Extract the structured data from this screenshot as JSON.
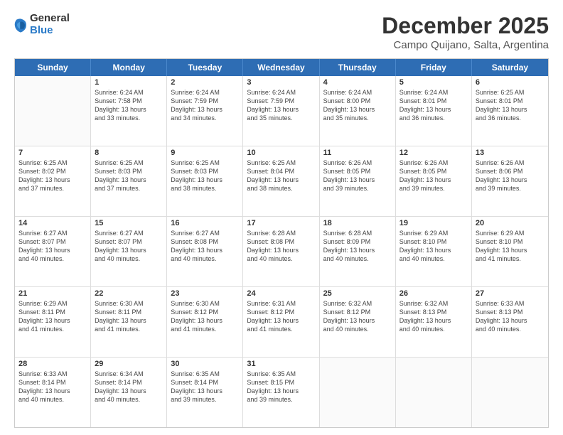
{
  "logo": {
    "general": "General",
    "blue": "Blue"
  },
  "header": {
    "month": "December 2025",
    "location": "Campo Quijano, Salta, Argentina"
  },
  "weekdays": [
    "Sunday",
    "Monday",
    "Tuesday",
    "Wednesday",
    "Thursday",
    "Friday",
    "Saturday"
  ],
  "weeks": [
    [
      {
        "day": "",
        "info": ""
      },
      {
        "day": "1",
        "info": "Sunrise: 6:24 AM\nSunset: 7:58 PM\nDaylight: 13 hours\nand 33 minutes."
      },
      {
        "day": "2",
        "info": "Sunrise: 6:24 AM\nSunset: 7:59 PM\nDaylight: 13 hours\nand 34 minutes."
      },
      {
        "day": "3",
        "info": "Sunrise: 6:24 AM\nSunset: 7:59 PM\nDaylight: 13 hours\nand 35 minutes."
      },
      {
        "day": "4",
        "info": "Sunrise: 6:24 AM\nSunset: 8:00 PM\nDaylight: 13 hours\nand 35 minutes."
      },
      {
        "day": "5",
        "info": "Sunrise: 6:24 AM\nSunset: 8:01 PM\nDaylight: 13 hours\nand 36 minutes."
      },
      {
        "day": "6",
        "info": "Sunrise: 6:25 AM\nSunset: 8:01 PM\nDaylight: 13 hours\nand 36 minutes."
      }
    ],
    [
      {
        "day": "7",
        "info": "Sunrise: 6:25 AM\nSunset: 8:02 PM\nDaylight: 13 hours\nand 37 minutes."
      },
      {
        "day": "8",
        "info": "Sunrise: 6:25 AM\nSunset: 8:03 PM\nDaylight: 13 hours\nand 37 minutes."
      },
      {
        "day": "9",
        "info": "Sunrise: 6:25 AM\nSunset: 8:03 PM\nDaylight: 13 hours\nand 38 minutes."
      },
      {
        "day": "10",
        "info": "Sunrise: 6:25 AM\nSunset: 8:04 PM\nDaylight: 13 hours\nand 38 minutes."
      },
      {
        "day": "11",
        "info": "Sunrise: 6:26 AM\nSunset: 8:05 PM\nDaylight: 13 hours\nand 39 minutes."
      },
      {
        "day": "12",
        "info": "Sunrise: 6:26 AM\nSunset: 8:05 PM\nDaylight: 13 hours\nand 39 minutes."
      },
      {
        "day": "13",
        "info": "Sunrise: 6:26 AM\nSunset: 8:06 PM\nDaylight: 13 hours\nand 39 minutes."
      }
    ],
    [
      {
        "day": "14",
        "info": "Sunrise: 6:27 AM\nSunset: 8:07 PM\nDaylight: 13 hours\nand 40 minutes."
      },
      {
        "day": "15",
        "info": "Sunrise: 6:27 AM\nSunset: 8:07 PM\nDaylight: 13 hours\nand 40 minutes."
      },
      {
        "day": "16",
        "info": "Sunrise: 6:27 AM\nSunset: 8:08 PM\nDaylight: 13 hours\nand 40 minutes."
      },
      {
        "day": "17",
        "info": "Sunrise: 6:28 AM\nSunset: 8:08 PM\nDaylight: 13 hours\nand 40 minutes."
      },
      {
        "day": "18",
        "info": "Sunrise: 6:28 AM\nSunset: 8:09 PM\nDaylight: 13 hours\nand 40 minutes."
      },
      {
        "day": "19",
        "info": "Sunrise: 6:29 AM\nSunset: 8:10 PM\nDaylight: 13 hours\nand 40 minutes."
      },
      {
        "day": "20",
        "info": "Sunrise: 6:29 AM\nSunset: 8:10 PM\nDaylight: 13 hours\nand 41 minutes."
      }
    ],
    [
      {
        "day": "21",
        "info": "Sunrise: 6:29 AM\nSunset: 8:11 PM\nDaylight: 13 hours\nand 41 minutes."
      },
      {
        "day": "22",
        "info": "Sunrise: 6:30 AM\nSunset: 8:11 PM\nDaylight: 13 hours\nand 41 minutes."
      },
      {
        "day": "23",
        "info": "Sunrise: 6:30 AM\nSunset: 8:12 PM\nDaylight: 13 hours\nand 41 minutes."
      },
      {
        "day": "24",
        "info": "Sunrise: 6:31 AM\nSunset: 8:12 PM\nDaylight: 13 hours\nand 41 minutes."
      },
      {
        "day": "25",
        "info": "Sunrise: 6:32 AM\nSunset: 8:12 PM\nDaylight: 13 hours\nand 40 minutes."
      },
      {
        "day": "26",
        "info": "Sunrise: 6:32 AM\nSunset: 8:13 PM\nDaylight: 13 hours\nand 40 minutes."
      },
      {
        "day": "27",
        "info": "Sunrise: 6:33 AM\nSunset: 8:13 PM\nDaylight: 13 hours\nand 40 minutes."
      }
    ],
    [
      {
        "day": "28",
        "info": "Sunrise: 6:33 AM\nSunset: 8:14 PM\nDaylight: 13 hours\nand 40 minutes."
      },
      {
        "day": "29",
        "info": "Sunrise: 6:34 AM\nSunset: 8:14 PM\nDaylight: 13 hours\nand 40 minutes."
      },
      {
        "day": "30",
        "info": "Sunrise: 6:35 AM\nSunset: 8:14 PM\nDaylight: 13 hours\nand 39 minutes."
      },
      {
        "day": "31",
        "info": "Sunrise: 6:35 AM\nSunset: 8:15 PM\nDaylight: 13 hours\nand 39 minutes."
      },
      {
        "day": "",
        "info": ""
      },
      {
        "day": "",
        "info": ""
      },
      {
        "day": "",
        "info": ""
      }
    ]
  ]
}
